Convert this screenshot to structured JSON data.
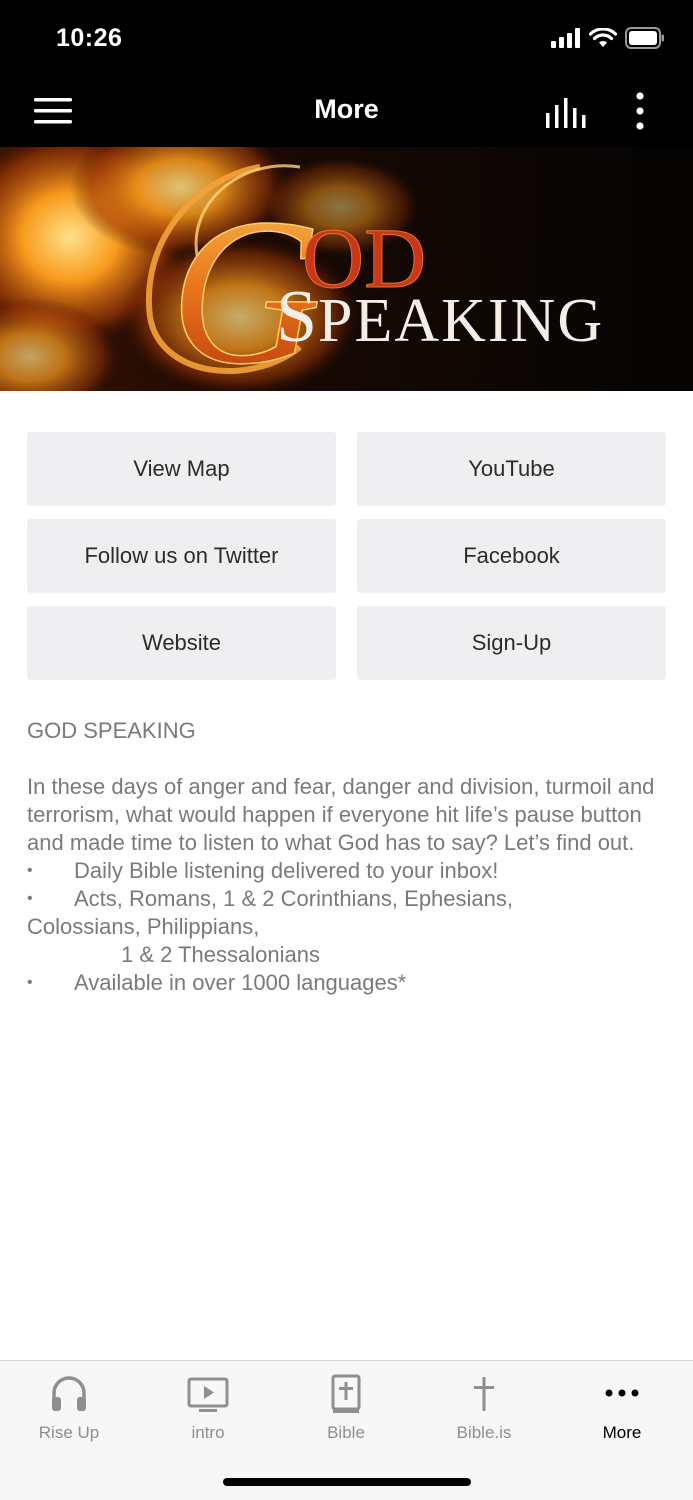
{
  "status_bar": {
    "time": "10:26"
  },
  "nav": {
    "title": "More"
  },
  "banner": {
    "line1_big": "G",
    "line1_rest": "OD",
    "line2_big": "S",
    "line2_rest": "PEAKING"
  },
  "buttons": [
    {
      "label": "View Map"
    },
    {
      "label": "YouTube"
    },
    {
      "label": "Follow us on Twitter"
    },
    {
      "label": "Facebook"
    },
    {
      "label": "Website"
    },
    {
      "label": "Sign-Up"
    }
  ],
  "content": {
    "heading": "GOD SPEAKING",
    "paragraph": "In these days of anger and fear, danger and division, turmoil and terrorism, what would happen if everyone hit life’s pause button and made time to listen to what God has to say? Let’s find out.",
    "bullet_char": "•",
    "bullet1": "Daily Bible listening delivered to your inbox!",
    "bullet2": "Acts, Romans, 1 & 2 Corinthians, Ephesians,",
    "bullet2_cont": "Colossians, Philippians,",
    "bullet2_indent": "1 & 2 Thessalonians",
    "bullet3": "Available in over 1000 languages*"
  },
  "tabs": [
    {
      "label": "Rise Up",
      "icon": "headphones-icon",
      "active": false
    },
    {
      "label": "intro",
      "icon": "tv-play-icon",
      "active": false
    },
    {
      "label": "Bible",
      "icon": "bible-book-icon",
      "active": false
    },
    {
      "label": "Bible.is",
      "icon": "cross-icon",
      "active": false
    },
    {
      "label": "More",
      "icon": "more-dots-icon",
      "active": true
    }
  ]
}
